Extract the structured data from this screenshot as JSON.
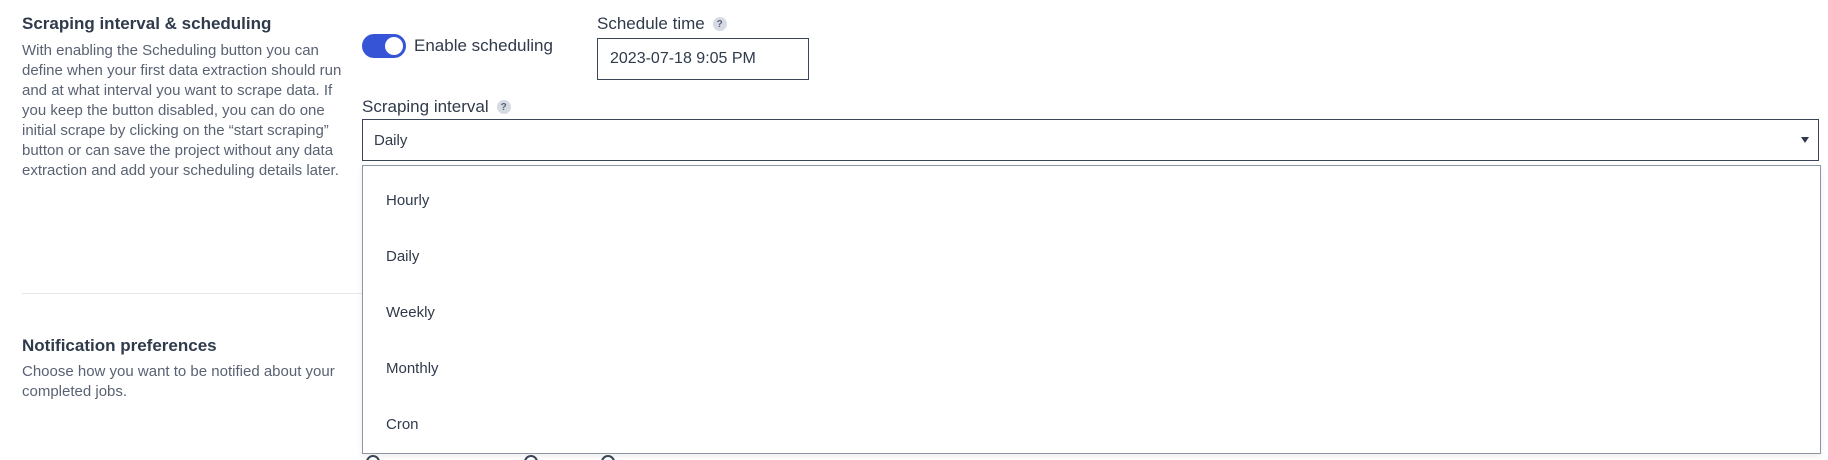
{
  "scheduling": {
    "title": "Scraping interval & scheduling",
    "description": "With enabling the Scheduling button you can define when your first data extraction should run and at what interval you want to scrape data. If you keep the button disabled, you can do one initial scrape by clicking on the “start scraping” button or can save the project without any data extraction and add your scheduling details later.",
    "toggle_label": "Enable scheduling",
    "toggle_on": true,
    "schedule_time_label": "Schedule time",
    "schedule_time_value": "2023-07-18 9:05 PM",
    "interval_label": "Scraping interval",
    "interval_selected": "Daily",
    "interval_options": [
      "Hourly",
      "Daily",
      "Weekly",
      "Monthly",
      "Cron"
    ],
    "help_glyph": "?"
  },
  "notifications": {
    "title": "Notification preferences",
    "description": "Choose how you want to be notified about your completed jobs."
  },
  "colors": {
    "accent": "#3554d6",
    "text": "#2f3a4b",
    "muted": "#596273"
  },
  "icons": [
    "help-icon",
    "caret-down-icon"
  ]
}
